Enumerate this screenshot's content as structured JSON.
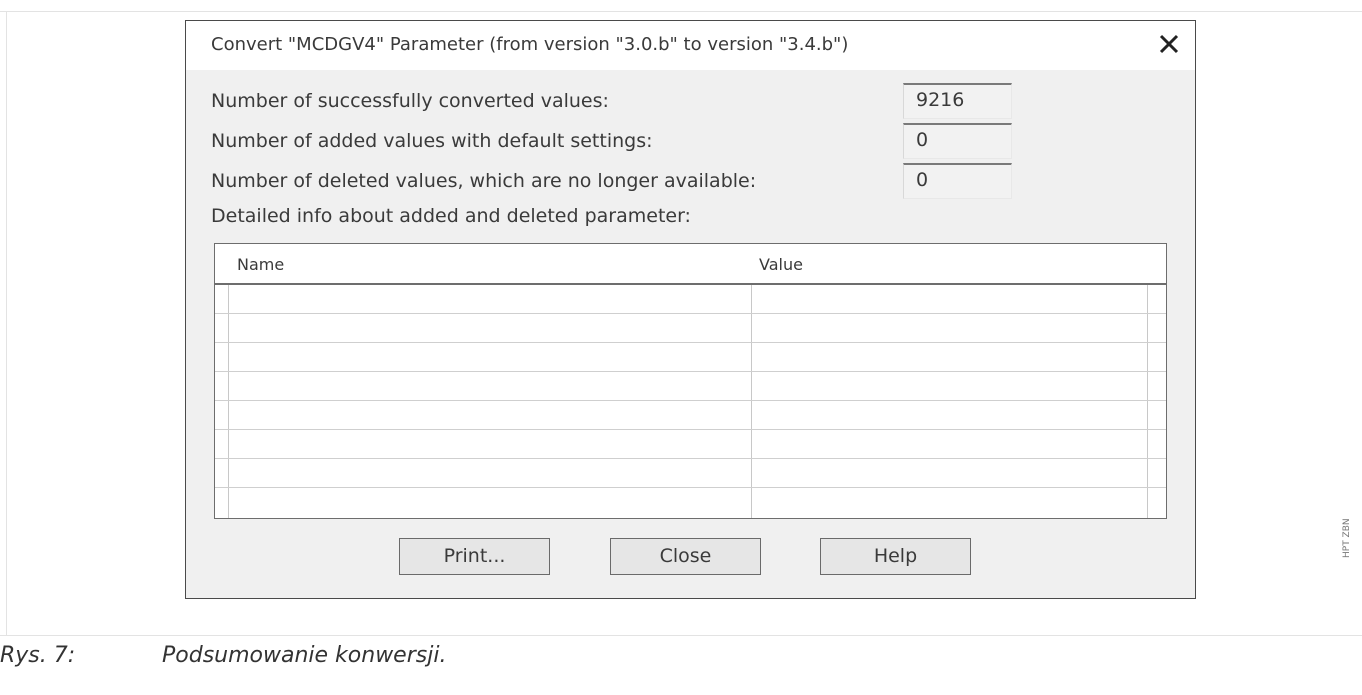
{
  "dialog": {
    "title": "Convert \"MCDGV4\" Parameter (from version \"3.0.b\" to version \"3.4.b\")",
    "close_icon": "close-icon",
    "rows": [
      {
        "label": "Number of successfully converted values:",
        "value": "9216"
      },
      {
        "label": "Number of added values with default settings:",
        "value": "0"
      },
      {
        "label": "Number of deleted values, which are no longer available:",
        "value": "0"
      }
    ],
    "detail_label": "Detailed info about added and deleted parameter:",
    "table": {
      "columns": [
        "Name",
        "Value"
      ],
      "rows": []
    },
    "buttons": {
      "print": "Print...",
      "close": "Close",
      "help": "Help"
    }
  },
  "caption": {
    "number": "Rys. 7:",
    "text": "Podsumowanie konwersji."
  },
  "side_code": "HPT ZBN"
}
